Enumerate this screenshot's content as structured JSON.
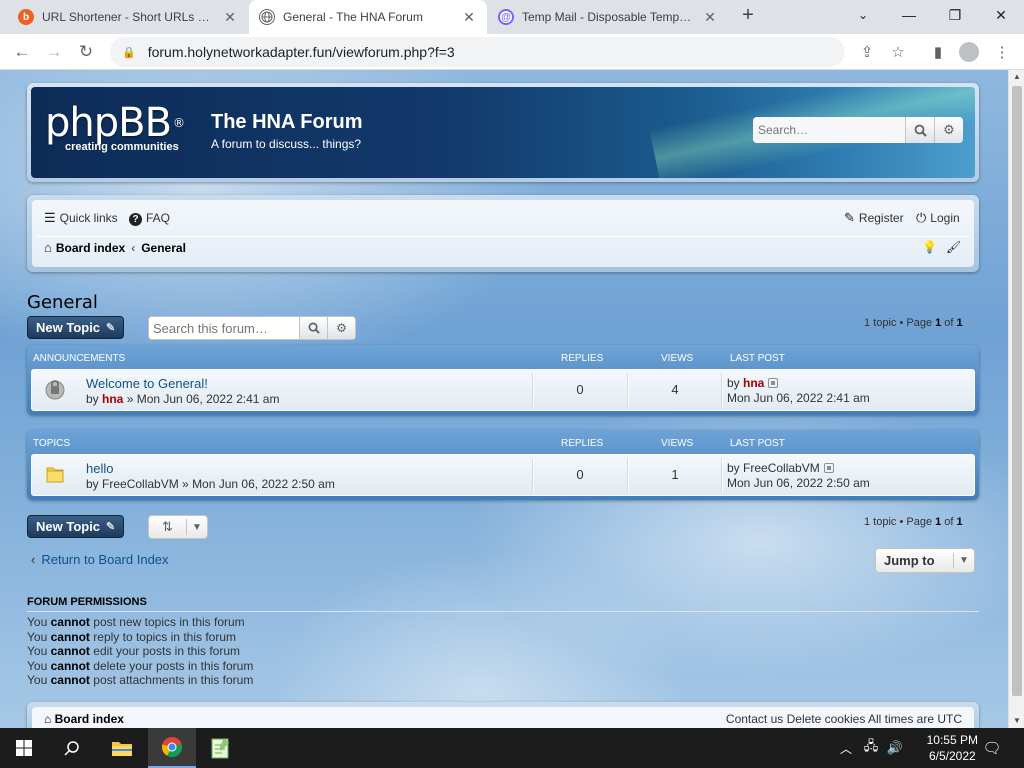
{
  "browser": {
    "tabs": [
      {
        "title": "URL Shortener - Short URLs & Cu",
        "favicon": "bitly-icon",
        "active": false
      },
      {
        "title": "General - The HNA Forum",
        "favicon": "globe-icon",
        "active": true
      },
      {
        "title": "Temp Mail - Disposable Tempora",
        "favicon": "tempmail-icon",
        "active": false
      }
    ],
    "url": "forum.holynetworkadapter.fun/viewforum.php?f=3"
  },
  "header": {
    "logo_text": "phpBB",
    "logo_tagline": "creating communities",
    "site_title": "The HNA Forum",
    "site_description": "A forum to discuss... things?",
    "search_placeholder": "Search…"
  },
  "nav": {
    "quick_links": "Quick links",
    "faq": "FAQ",
    "register": "Register",
    "login": "Login",
    "breadcrumb": [
      "Board index",
      "General"
    ]
  },
  "forum": {
    "title": "General",
    "new_topic_label": "New Topic",
    "search_placeholder": "Search this forum…",
    "pagination_top": {
      "count_text": "1 topic • Page ",
      "page": "1",
      "of_text": " of ",
      "total": "1"
    },
    "pagination_bottom": {
      "count_text": "1 topic • Page ",
      "page": "1",
      "of_text": " of ",
      "total": "1"
    },
    "announcements": {
      "header": "ANNOUNCEMENTS",
      "col_replies": "REPLIES",
      "col_views": "VIEWS",
      "col_last_post": "LAST POST",
      "rows": [
        {
          "title": "Welcome to General!",
          "by": "by ",
          "author": "hna",
          "sep": " » ",
          "date": "Mon Jun 06, 2022 2:41 am",
          "replies": "0",
          "views": "4",
          "last_by": "by ",
          "last_author": "hna",
          "last_date": "Mon Jun 06, 2022 2:41 am"
        }
      ]
    },
    "topics": {
      "header": "TOPICS",
      "col_replies": "REPLIES",
      "col_views": "VIEWS",
      "col_last_post": "LAST POST",
      "rows": [
        {
          "title": "hello",
          "by": "by ",
          "author": "FreeCollabVM",
          "sep": " » ",
          "date": "Mon Jun 06, 2022 2:50 am",
          "replies": "0",
          "views": "1",
          "last_by": "by ",
          "last_author": "FreeCollabVM",
          "last_date": "Mon Jun 06, 2022 2:50 am"
        }
      ]
    },
    "return_link": "Return to Board Index",
    "jump_to": "Jump to",
    "permissions": {
      "title": "FORUM PERMISSIONS",
      "lines": [
        {
          "pre": "You ",
          "strong": "cannot",
          "post": " post new topics in this forum"
        },
        {
          "pre": "You ",
          "strong": "cannot",
          "post": " reply to topics in this forum"
        },
        {
          "pre": "You ",
          "strong": "cannot",
          "post": " edit your posts in this forum"
        },
        {
          "pre": "You ",
          "strong": "cannot",
          "post": " delete your posts in this forum"
        },
        {
          "pre": "You ",
          "strong": "cannot",
          "post": " post attachments in this forum"
        }
      ]
    },
    "footer_left": "Board index",
    "footer_right": "Contact us   Delete cookies   All times are UTC"
  },
  "taskbar": {
    "time": "10:55 PM",
    "date": "6/5/2022"
  },
  "colors": {
    "link": "#105289",
    "button_dark": "#1d3a5c",
    "user_red": "#aa0000"
  }
}
